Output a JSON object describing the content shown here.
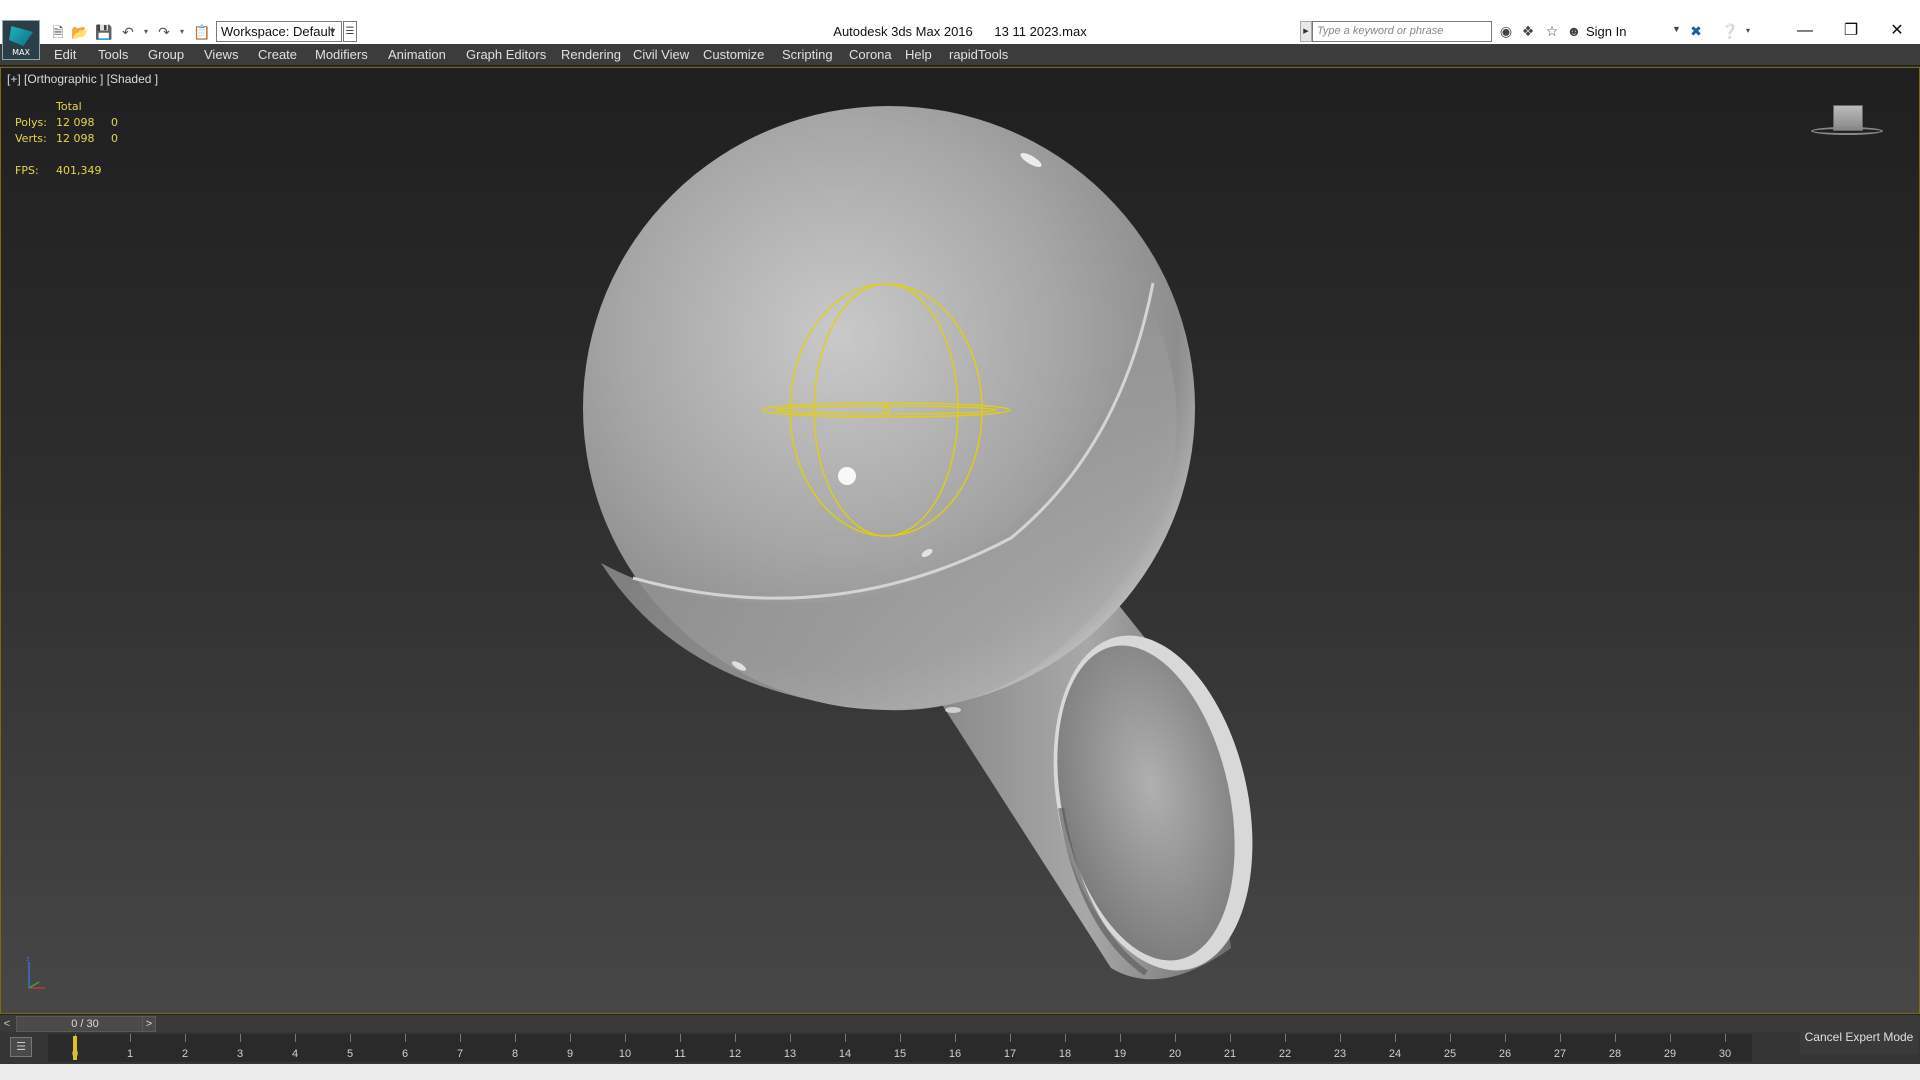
{
  "window": {
    "title": "Autodesk 3ds Max 2016      13 11 2023.max",
    "logo_text": "MAX"
  },
  "toolbar": {
    "workspace": "Workspace: Default",
    "search_placeholder": "Type a keyword or phrase",
    "sign_in": "Sign In",
    "icons": [
      "new-file-icon",
      "open-file-icon",
      "save-icon",
      "undo-icon",
      "redo-icon",
      "project-icon"
    ]
  },
  "menu": {
    "items": [
      "Edit",
      "Tools",
      "Group",
      "Views",
      "Create",
      "Modifiers",
      "Animation",
      "Graph Editors",
      "Rendering",
      "Civil View",
      "Customize",
      "Scripting",
      "Corona",
      "Help",
      "rapidTools"
    ]
  },
  "viewport": {
    "label": "[+] [Orthographic ] [Shaded ]",
    "stats": {
      "header": "Total",
      "polys_label": "Polys:",
      "polys_total": "12 098",
      "polys_sel": "0",
      "verts_label": "Verts:",
      "verts_total": "12 098",
      "verts_sel": "0",
      "fps_label": "FPS:",
      "fps_value": "401,349"
    },
    "colors": {
      "stats": "#e8d44a",
      "border": "#7a6b12",
      "gizmo": "#e6d000"
    }
  },
  "timeline": {
    "slider_text": "0 / 30",
    "prev": "<",
    "next": ">",
    "frames": [
      "0",
      "1",
      "2",
      "3",
      "4",
      "5",
      "6",
      "7",
      "8",
      "9",
      "10",
      "11",
      "12",
      "13",
      "14",
      "15",
      "16",
      "17",
      "18",
      "19",
      "20",
      "21",
      "22",
      "23",
      "24",
      "25",
      "26",
      "27",
      "28",
      "29",
      "30"
    ],
    "current_frame": 0
  },
  "status": {
    "cancel_expert": "Cancel Expert Mode"
  }
}
